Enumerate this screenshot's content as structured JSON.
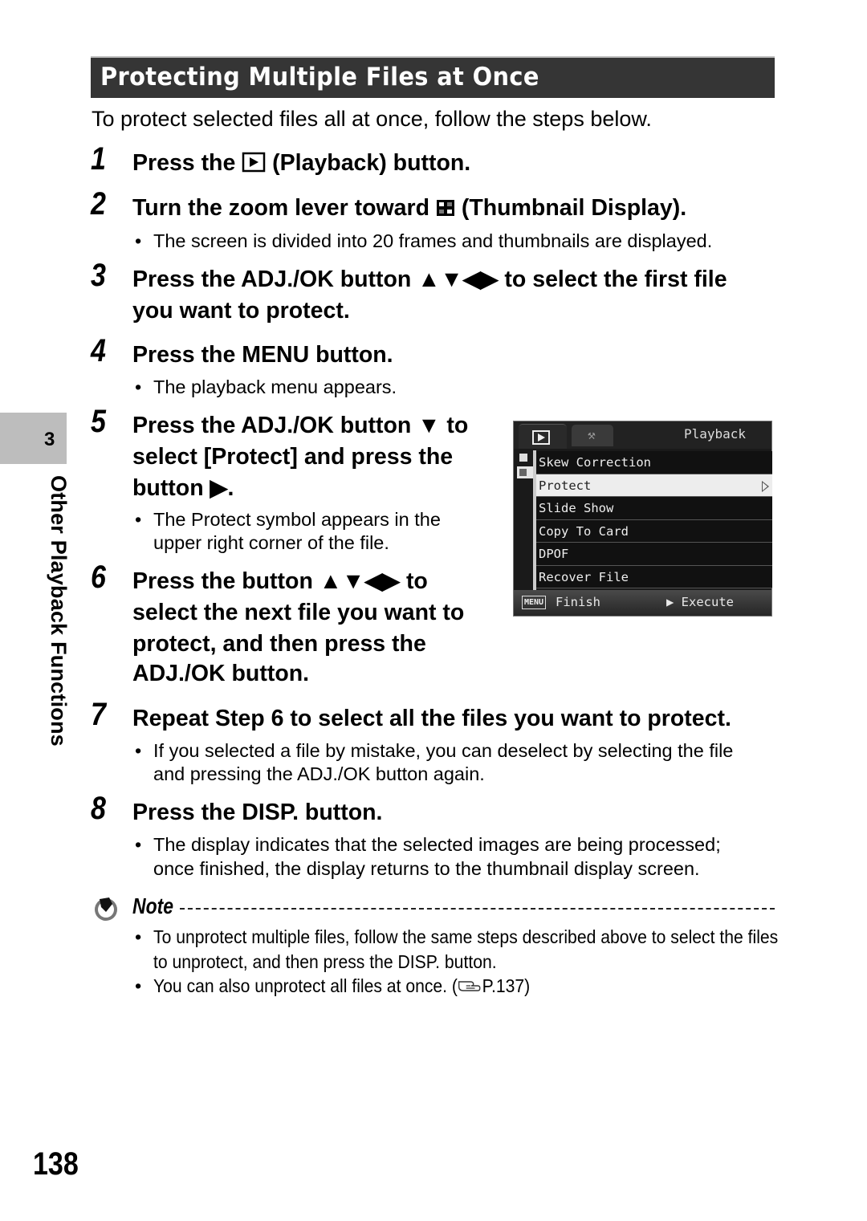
{
  "section": {
    "title": "Protecting Multiple Files at Once",
    "intro": "To protect selected files all at once, follow the steps below."
  },
  "side_tab": {
    "chapter_number": "3",
    "chapter_title": "Other Playback Functions"
  },
  "steps": [
    {
      "number": "1",
      "lines": [
        "Press the",
        "(Playback) button."
      ],
      "icon": "playback-icon",
      "bullets": []
    },
    {
      "number": "2",
      "lines": [
        "Turn the zoom lever toward",
        "(Thumbnail Display)."
      ],
      "icon": "thumbnail-display-icon",
      "bullets": [
        "The screen is divided into 20 frames and thumbnails are displayed."
      ]
    },
    {
      "number": "3",
      "lines": [
        "Press the ADJ./OK button ▲▼◀▶ to select the first file",
        "you want to protect."
      ],
      "bullets": []
    },
    {
      "number": "4",
      "lines": [
        "Press the MENU button."
      ],
      "bullets": [
        "The playback menu appears."
      ]
    },
    {
      "number": "5",
      "lines": [
        "Press the ADJ./OK button ▼ to",
        "select [Protect] and press the",
        "button ▶."
      ],
      "bullets": [
        "The Protect symbol appears in the",
        "upper right corner of the file."
      ]
    },
    {
      "number": "6",
      "lines": [
        "Press the button ▲▼◀▶ to",
        "select the next file you want to",
        "protect, and then press the",
        "ADJ./OK button."
      ],
      "bullets": []
    },
    {
      "number": "7",
      "lines": [
        "Repeat Step 6 to select all the files you want to protect."
      ],
      "bullets": [
        "If you selected a file by mistake, you can deselect by selecting the file",
        "and pressing the ADJ./OK button again."
      ]
    },
    {
      "number": "8",
      "lines": [
        "Press the DISP. button."
      ],
      "bullets": [
        "The display indicates that the selected images are being processed;",
        "once finished, the display returns to the thumbnail display screen."
      ]
    }
  ],
  "camera_menu": {
    "title": "Playback",
    "tabs": [
      "playback-tab",
      "setup-tab"
    ],
    "items": [
      {
        "label": "Skew Correction",
        "selected": false
      },
      {
        "label": "Protect",
        "selected": true
      },
      {
        "label": "Slide Show",
        "selected": false
      },
      {
        "label": "Copy To Card",
        "selected": false
      },
      {
        "label": "DPOF",
        "selected": false
      },
      {
        "label": "Recover File",
        "selected": false
      }
    ],
    "footer": {
      "menu_key": "MENU",
      "finish": "Finish",
      "execute": "▶ Execute"
    }
  },
  "note": {
    "label": "Note",
    "bullets": [
      "To unprotect multiple files, follow the same steps described above to select the files",
      "to unprotect, and then press the DISP. button.",
      "You can also unprotect all files at once. (",
      "P.137)"
    ]
  },
  "page_number": "138"
}
